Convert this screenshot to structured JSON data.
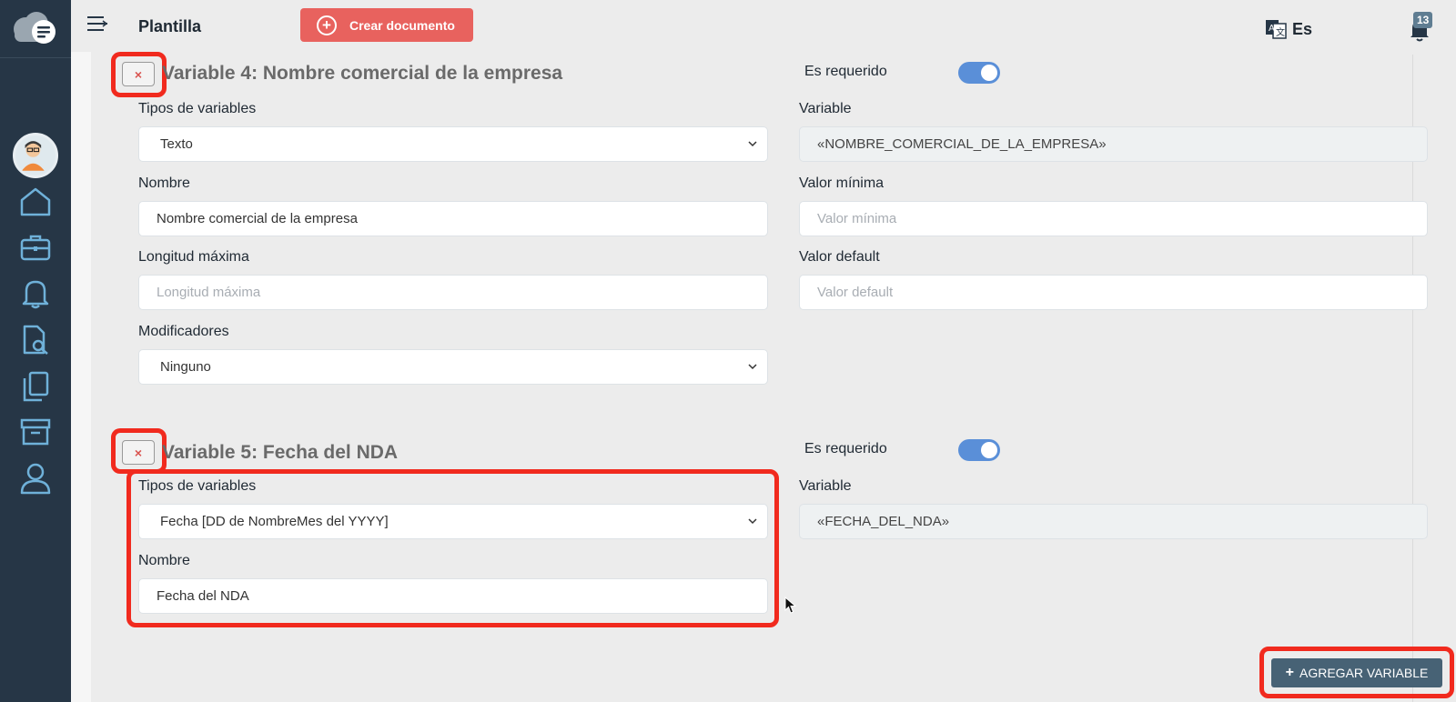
{
  "header": {
    "title": "Plantilla",
    "create_button": "Crear documento",
    "language": "Es",
    "notifications_count": "13"
  },
  "sidebar": {
    "items": [
      {
        "icon": "home-icon"
      },
      {
        "icon": "briefcase-icon"
      },
      {
        "icon": "bell-icon"
      },
      {
        "icon": "document-search-icon"
      },
      {
        "icon": "copy-icon"
      },
      {
        "icon": "archive-icon"
      },
      {
        "icon": "user-icon"
      }
    ]
  },
  "variable4": {
    "delete": "×",
    "title": "Variable 4: Nombre comercial de la empresa",
    "required_label": "Es requerido",
    "required": true,
    "type_label": "Tipos de variables",
    "type_value": "Texto",
    "variable_label": "Variable",
    "variable_value": "«NOMBRE_COMERCIAL_DE_LA_EMPRESA»",
    "name_label": "Nombre",
    "name_value": "Nombre comercial de la empresa",
    "min_label": "Valor mínima",
    "min_placeholder": "Valor mínima",
    "maxlen_label": "Longitud máxima",
    "maxlen_placeholder": "Longitud máxima",
    "default_label": "Valor default",
    "default_placeholder": "Valor default",
    "modifiers_label": "Modificadores",
    "modifiers_value": "Ninguno"
  },
  "variable5": {
    "delete": "×",
    "title": "Variable 5: Fecha del NDA",
    "required_label": "Es requerido",
    "required": true,
    "type_label": "Tipos de variables",
    "type_value": "Fecha [DD de NombreMes del YYYY]",
    "variable_label": "Variable",
    "variable_value": "«FECHA_DEL_NDA»",
    "name_label": "Nombre",
    "name_value": "Fecha del NDA"
  },
  "add_variable_button": "AGREGAR VARIABLE",
  "colors": {
    "sidebar": "#263646",
    "create_button": "#e8625e",
    "toggle_on": "#5a8fd8",
    "add_button": "#476275",
    "highlight": "#f12a1e"
  }
}
